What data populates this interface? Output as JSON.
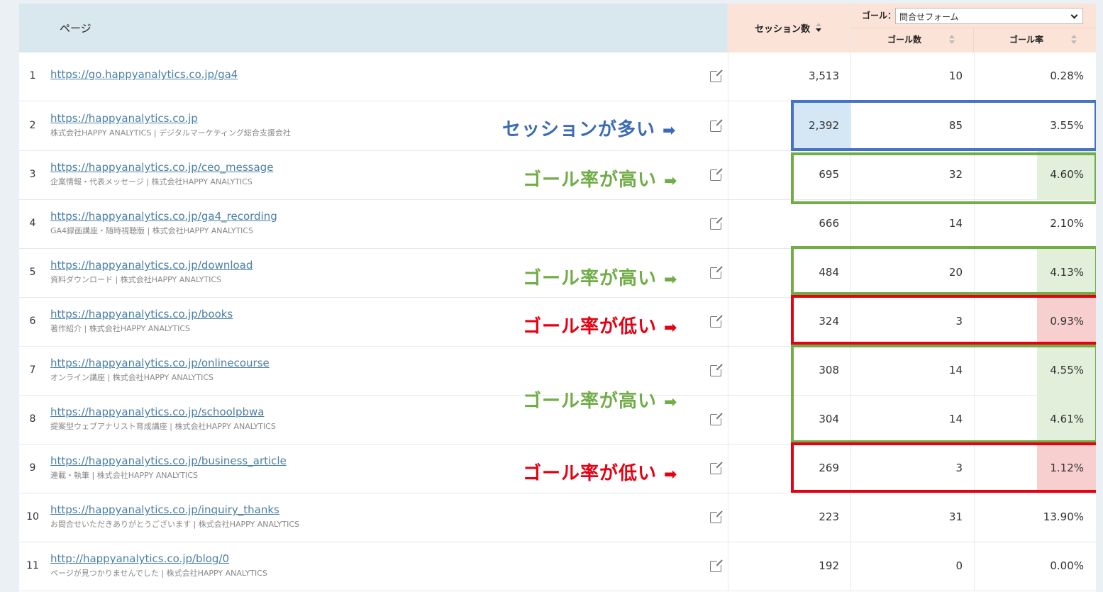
{
  "header": {
    "page_label": "ページ",
    "sessions_label": "セッション数",
    "goal_label": "ゴール：",
    "goal_select_value": "問合せフォーム",
    "goal_count_label": "ゴール数",
    "goal_rate_label": "ゴール率"
  },
  "rows": [
    {
      "num": "1",
      "url": "https://go.happyanalytics.co.jp/ga4",
      "title": "",
      "sessions": "3,513",
      "goals": "10",
      "rate": "0.28%"
    },
    {
      "num": "2",
      "url": "https://happyanalytics.co.jp",
      "title": "株式会社HAPPY ANALYTICS | デジタルマーケティング総合支援会社",
      "sessions": "2,392",
      "goals": "85",
      "rate": "3.55%"
    },
    {
      "num": "3",
      "url": "https://happyanalytics.co.jp/ceo_message",
      "title": "企業情報・代表メッセージ | 株式会社HAPPY ANALYTICS",
      "sessions": "695",
      "goals": "32",
      "rate": "4.60%"
    },
    {
      "num": "4",
      "url": "https://happyanalytics.co.jp/ga4_recording",
      "title": "GA4録画講座・随時視聴版 | 株式会社HAPPY ANALYTICS",
      "sessions": "666",
      "goals": "14",
      "rate": "2.10%"
    },
    {
      "num": "5",
      "url": "https://happyanalytics.co.jp/download",
      "title": "資料ダウンロード | 株式会社HAPPY ANALYTICS",
      "sessions": "484",
      "goals": "20",
      "rate": "4.13%"
    },
    {
      "num": "6",
      "url": "https://happyanalytics.co.jp/books",
      "title": "著作紹介 | 株式会社HAPPY ANALYTICS",
      "sessions": "324",
      "goals": "3",
      "rate": "0.93%"
    },
    {
      "num": "7",
      "url": "https://happyanalytics.co.jp/onlinecourse",
      "title": "オンライン講座 | 株式会社HAPPY ANALYTICS",
      "sessions": "308",
      "goals": "14",
      "rate": "4.55%"
    },
    {
      "num": "8",
      "url": "https://happyanalytics.co.jp/schoolpbwa",
      "title": "提案型ウェブアナリスト育成講座 | 株式会社HAPPY ANALYTICS",
      "sessions": "304",
      "goals": "14",
      "rate": "4.61%"
    },
    {
      "num": "9",
      "url": "https://happyanalytics.co.jp/business_article",
      "title": "連載・執筆 | 株式会社HAPPY ANALYTICS",
      "sessions": "269",
      "goals": "3",
      "rate": "1.12%"
    },
    {
      "num": "10",
      "url": "https://happyanalytics.co.jp/inquiry_thanks",
      "title": "お問合せいただきありがとうございます | 株式会社HAPPY ANALYTICS",
      "sessions": "223",
      "goals": "31",
      "rate": "13.90%"
    },
    {
      "num": "11",
      "url": "http://happyanalytics.co.jp/blog/0",
      "title": "ページが見つかりませんでした | 株式会社HAPPY ANALYTICS",
      "sessions": "192",
      "goals": "0",
      "rate": "0.00%"
    }
  ],
  "annotations": {
    "many_sessions": "セッションが多い",
    "high_rate": "ゴール率が高い",
    "low_rate": "ゴール率が低い",
    "arrow": "➡"
  },
  "colors": {
    "blue": "#4472c4",
    "green": "#70ad47",
    "red": "#e60012",
    "link": "#4a7fa6"
  }
}
